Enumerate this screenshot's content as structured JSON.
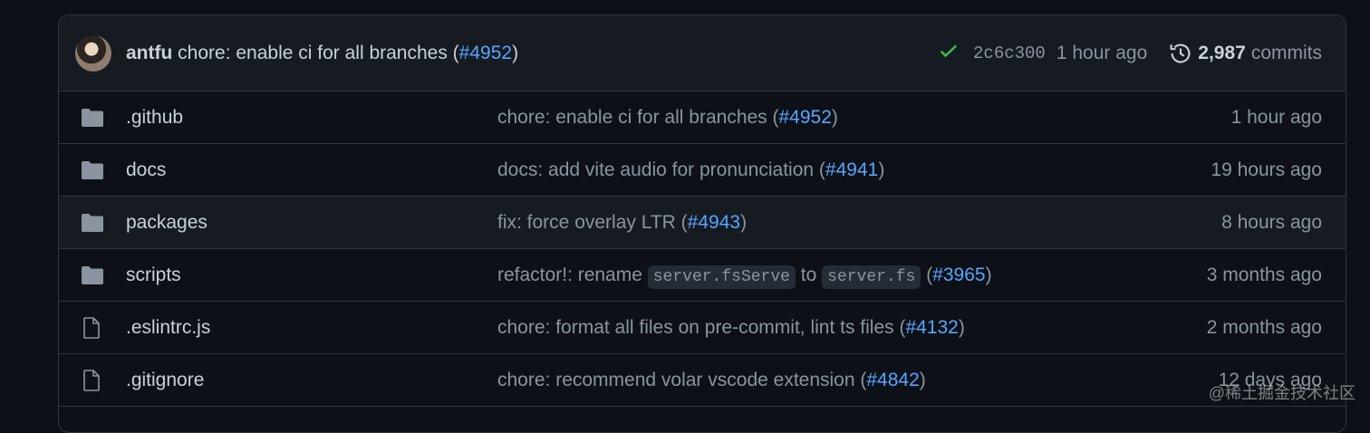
{
  "latest_commit": {
    "author": "antfu",
    "message": "chore: enable ci for all branches (",
    "pr": "#4952",
    "message_end": ")",
    "sha": "2c6c300",
    "time": "1 hour ago",
    "commit_count": "2,987",
    "commits_label": "commits"
  },
  "files": [
    {
      "name": ".github",
      "type": "folder",
      "msg_pre": "chore: enable ci for all branches (",
      "pr": "#4952",
      "msg_post": ")",
      "time": "1 hour ago"
    },
    {
      "name": "docs",
      "type": "folder",
      "msg_pre": "docs: add vite audio for pronunciation (",
      "pr": "#4941",
      "msg_post": ")",
      "time": "19 hours ago"
    },
    {
      "name": "packages",
      "type": "folder",
      "msg_pre": "fix: force overlay LTR (",
      "pr": "#4943",
      "msg_post": ")",
      "time": "8 hours ago"
    },
    {
      "name": "scripts",
      "type": "folder",
      "msg_pre": "refactor!: rename ",
      "code1": "server.fsServe",
      "msg_mid": " to ",
      "code2": "server.fs",
      "msg_mid2": " (",
      "pr": "#3965",
      "msg_post": ")",
      "time": "3 months ago"
    },
    {
      "name": ".eslintrc.js",
      "type": "file",
      "msg_pre": "chore: format all files on pre-commit, lint ts files (",
      "pr": "#4132",
      "msg_post": ")",
      "time": "2 months ago"
    },
    {
      "name": ".gitignore",
      "type": "file",
      "msg_pre": "chore: recommend volar vscode extension (",
      "pr": "#4842",
      "msg_post": ")",
      "time": "12 days ago"
    }
  ],
  "watermark": "@稀土掘金技术社区",
  "colors": {
    "link": "#58a6ff",
    "check": "#3fb950",
    "bg": "#0d1117"
  }
}
